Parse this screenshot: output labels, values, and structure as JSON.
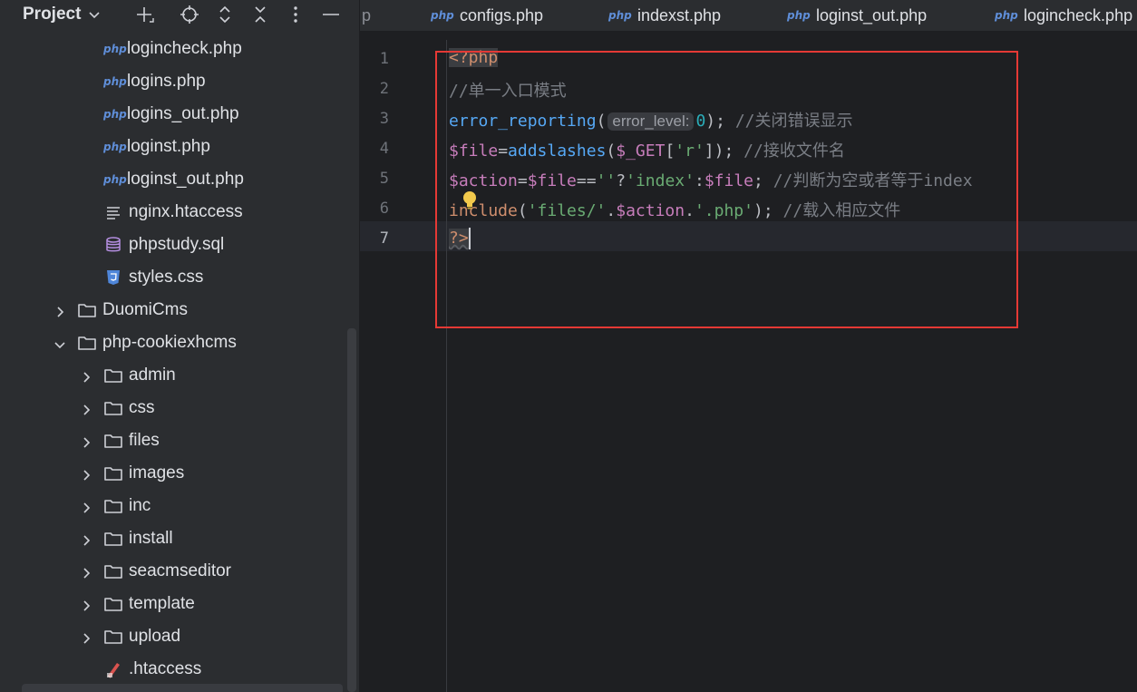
{
  "project_panel": {
    "title": "Project",
    "tree": [
      {
        "label": "logincheck.php",
        "type": "php",
        "indent": 2
      },
      {
        "label": "logins.php",
        "type": "php",
        "indent": 2
      },
      {
        "label": "logins_out.php",
        "type": "php",
        "indent": 2
      },
      {
        "label": "loginst.php",
        "type": "php",
        "indent": 2
      },
      {
        "label": "loginst_out.php",
        "type": "php",
        "indent": 2
      },
      {
        "label": "nginx.htaccess",
        "type": "text",
        "indent": 2
      },
      {
        "label": "phpstudy.sql",
        "type": "sql",
        "indent": 2
      },
      {
        "label": "styles.css",
        "type": "css",
        "indent": 2
      },
      {
        "label": "DuomiCms",
        "type": "folder",
        "indent": 1,
        "expanded": false
      },
      {
        "label": "php-cookiexhcms",
        "type": "folder",
        "indent": 1,
        "expanded": true
      },
      {
        "label": "admin",
        "type": "folder",
        "indent": 2,
        "expanded": false
      },
      {
        "label": "css",
        "type": "folder",
        "indent": 2,
        "expanded": false
      },
      {
        "label": "files",
        "type": "folder",
        "indent": 2,
        "expanded": false
      },
      {
        "label": "images",
        "type": "folder",
        "indent": 2,
        "expanded": false
      },
      {
        "label": "inc",
        "type": "folder",
        "indent": 2,
        "expanded": false
      },
      {
        "label": "install",
        "type": "folder",
        "indent": 2,
        "expanded": false
      },
      {
        "label": "seacmseditor",
        "type": "folder",
        "indent": 2,
        "expanded": false
      },
      {
        "label": "template",
        "type": "folder",
        "indent": 2,
        "expanded": false
      },
      {
        "label": "upload",
        "type": "folder",
        "indent": 2,
        "expanded": false
      },
      {
        "label": ".htaccess",
        "type": "htaccess",
        "indent": 2
      }
    ]
  },
  "tabs": [
    {
      "badge": "",
      "label": "p"
    },
    {
      "badge": "php",
      "label": "configs.php"
    },
    {
      "badge": "php",
      "label": "indexst.php"
    },
    {
      "badge": "php",
      "label": "loginst_out.php"
    },
    {
      "badge": "php",
      "label": "logincheck.php"
    }
  ],
  "editor": {
    "lines": [
      "1",
      "2",
      "3",
      "4",
      "5",
      "6",
      "7"
    ],
    "code": {
      "l1_tag": "<?php",
      "l2_comment": "//单一入口模式",
      "l3_fn": "error_reporting",
      "l3_open": "(",
      "l3_hint": "error_level:",
      "l3_num": "0",
      "l3_close": ");",
      "l3_comment": "//关闭错误显示",
      "l4_var": "$file",
      "l4_eq": "=",
      "l4_fn": "addslashes",
      "l4_open": "(",
      "l4_get": "$_GET",
      "l4_br1": "[",
      "l4_str": "'r'",
      "l4_br2": "]);",
      "l4_comment": "//接收文件名",
      "l5_var1": "$action",
      "l5_eq": "=",
      "l5_var2": "$file",
      "l5_op": "==",
      "l5_str1": "''",
      "l5_q": "?",
      "l5_str2": "'index'",
      "l5_colon": ":",
      "l5_var3": "$file",
      "l5_semi": ";",
      "l5_comment": "//判断为空或者等于index",
      "l6_fn": "include",
      "l6_open": "(",
      "l6_str1": "'files/'",
      "l6_dot1": ".",
      "l6_var": "$action",
      "l6_dot2": ".",
      "l6_str2": "'.php'",
      "l6_close": ");",
      "l6_comment": "//载入相应文件",
      "l7_tag": "?>"
    }
  },
  "colors": {
    "highlight_box": "#e53935",
    "php_badge": "#5f8ed8",
    "folder_icon": "#ced0d6"
  }
}
